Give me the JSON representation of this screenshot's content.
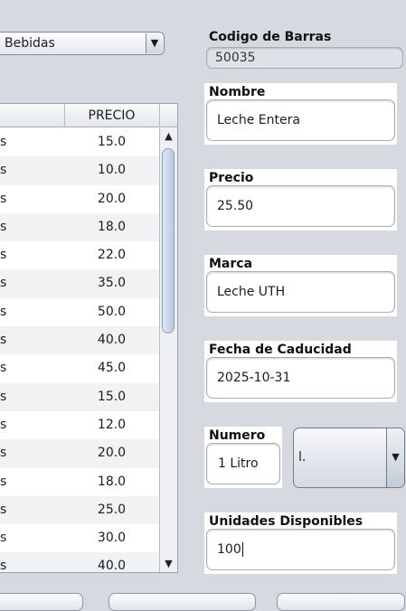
{
  "category_combo": {
    "value": "Bebidas",
    "arrow": "▼"
  },
  "table": {
    "headers": [
      "",
      "PRECIO"
    ],
    "rows": [
      {
        "c0": "s",
        "precio": "15.0"
      },
      {
        "c0": "s",
        "precio": "10.0"
      },
      {
        "c0": "s",
        "precio": "20.0"
      },
      {
        "c0": "s",
        "precio": "18.0"
      },
      {
        "c0": "s",
        "precio": "22.0"
      },
      {
        "c0": "s",
        "precio": "35.0"
      },
      {
        "c0": "s",
        "precio": "50.0"
      },
      {
        "c0": "s",
        "precio": "40.0"
      },
      {
        "c0": "s",
        "precio": "45.0"
      },
      {
        "c0": "s",
        "precio": "15.0"
      },
      {
        "c0": "s",
        "precio": "12.0"
      },
      {
        "c0": "s",
        "precio": "20.0"
      },
      {
        "c0": "s",
        "precio": "18.0"
      },
      {
        "c0": "s",
        "precio": "25.0"
      },
      {
        "c0": "s",
        "precio": "30.0"
      },
      {
        "c0": "s",
        "precio": "40.0"
      }
    ],
    "scroll_up": "▲",
    "scroll_down": "▼"
  },
  "form": {
    "barcode": {
      "label": "Codigo de Barras",
      "value": "50035"
    },
    "nombre": {
      "label": "Nombre",
      "value": "Leche Entera"
    },
    "precio": {
      "label": "Precio",
      "value": "25.50"
    },
    "marca": {
      "label": "Marca",
      "value": "Leche UTH"
    },
    "fecha": {
      "label": "Fecha de Caducidad",
      "value": "2025-10-31"
    },
    "numero": {
      "label": "Numero",
      "value": "1 Litro"
    },
    "unit_combo": {
      "value": "l.",
      "arrow": "▼"
    },
    "unidades": {
      "label": "Unidades Disponibles",
      "value": "100"
    }
  }
}
